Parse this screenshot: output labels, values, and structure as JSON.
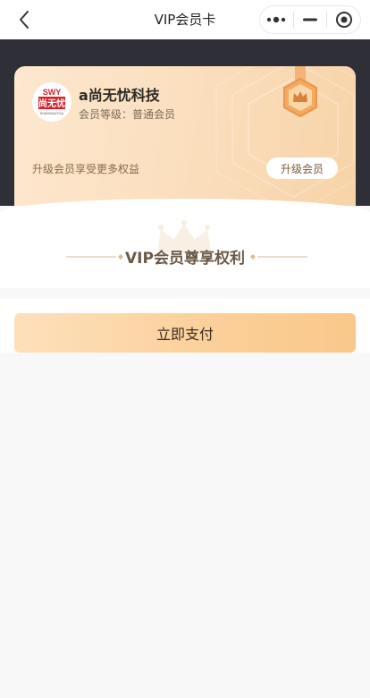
{
  "navbar": {
    "title": "VIP会员卡",
    "back_icon": "chevron-left-icon",
    "menu_icon": "more-dots-icon",
    "minimize_icon": "minus-icon",
    "close_icon": "target-circle-icon"
  },
  "card": {
    "brand_name": "a尚无忧科技",
    "member_level": "会员等级：普通会员",
    "upgrade_hint": "升级会员享受更多权益",
    "upgrade_button": "升级会员",
    "logo": {
      "top_text": "SWY",
      "main_text": "尚无忧",
      "sub_text": "SHANGWUYOU"
    },
    "badge_icon": "crown-badge-icon"
  },
  "privilege": {
    "title": "VIP会员尊享权利"
  },
  "pay": {
    "button_label": "立即支付"
  },
  "colors": {
    "dark_band": "#2f3037",
    "card_gradient_start": "#fde7cf",
    "card_gradient_end": "#f7d3a8",
    "pay_gradient_start": "#fde0bb",
    "pay_gradient_end": "#f9c88a",
    "logo_red": "#d8212a",
    "badge_orange": "#e8964a"
  }
}
